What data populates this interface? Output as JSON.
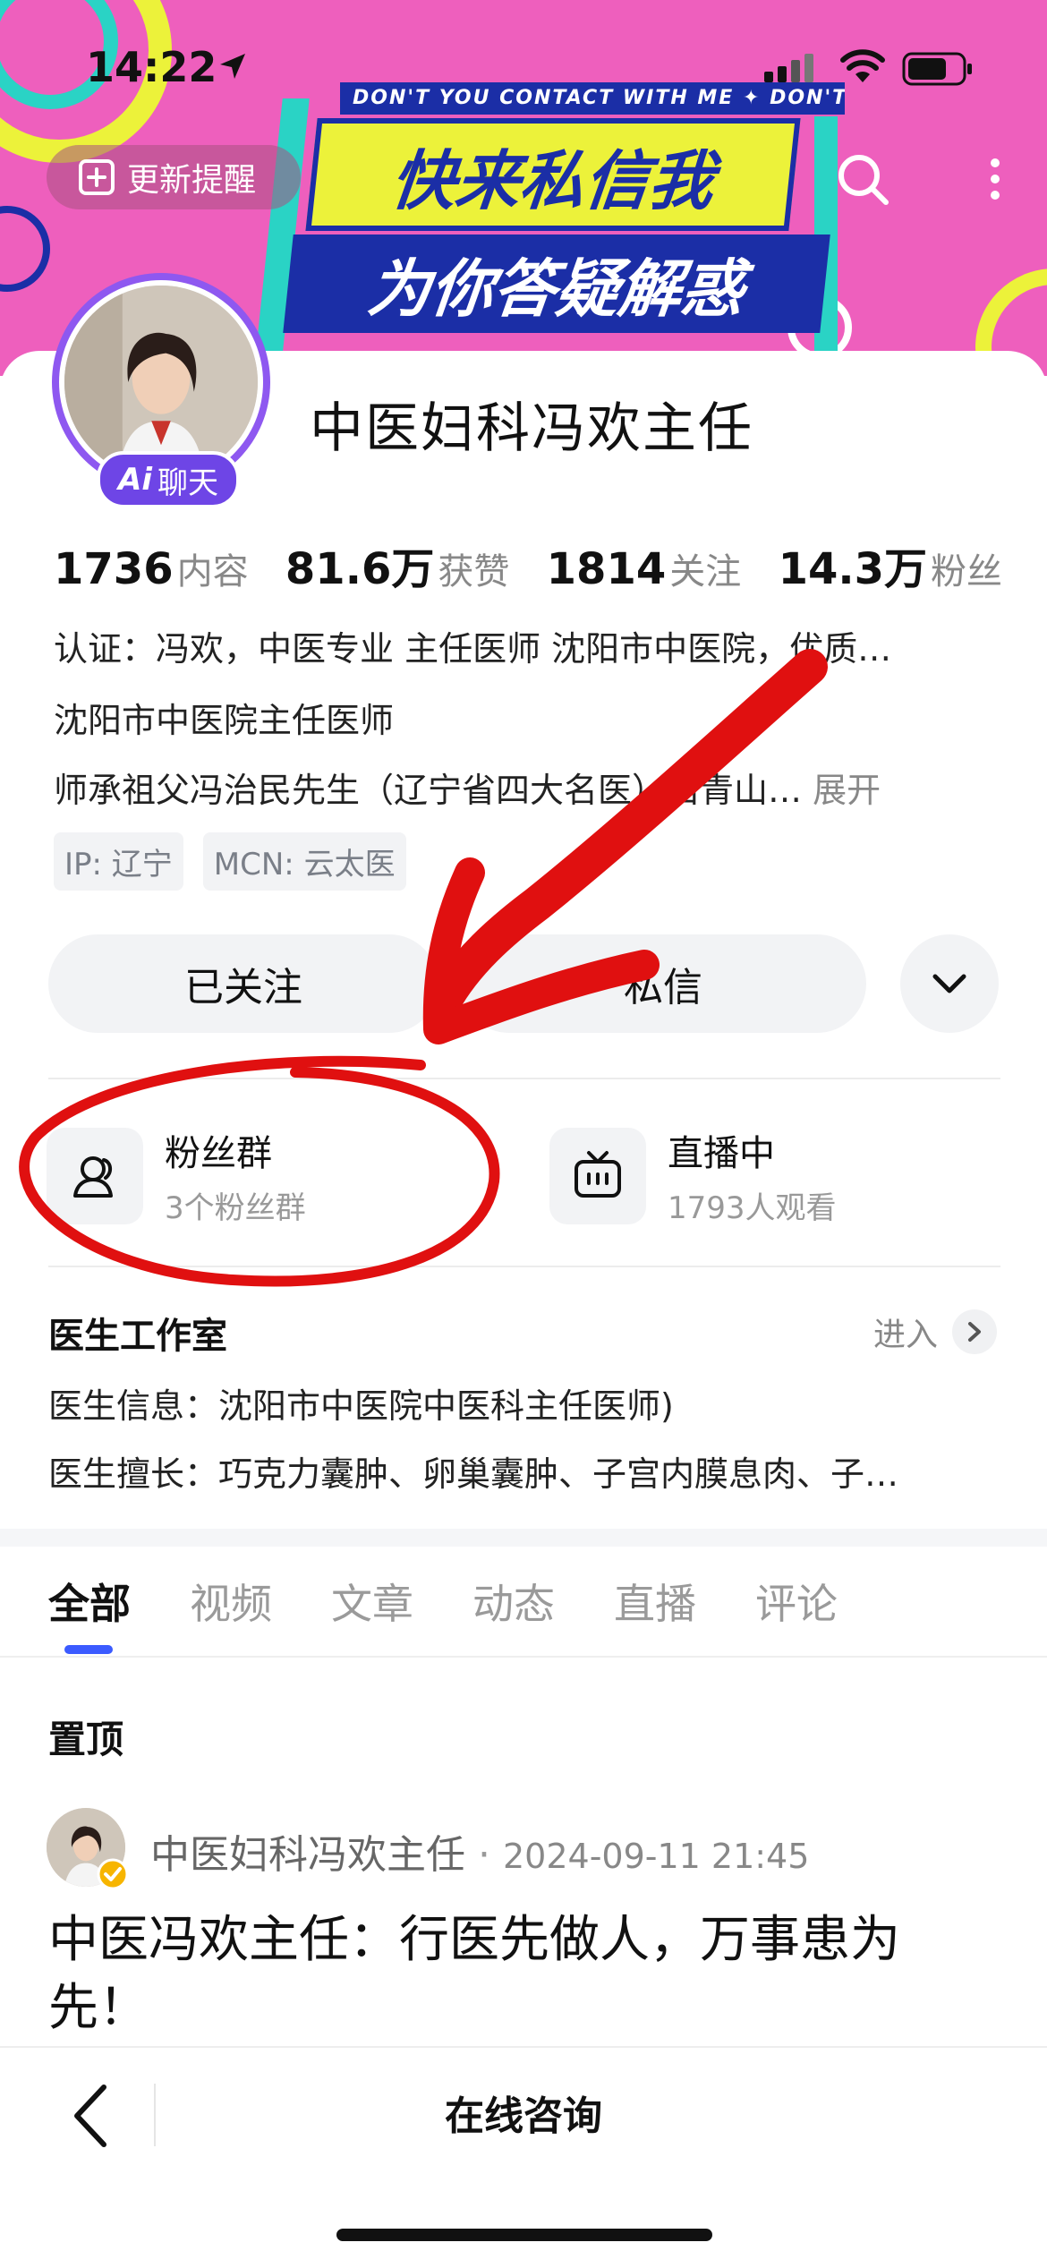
{
  "status_bar": {
    "time": "14:22"
  },
  "banner": {
    "tape_text": "DON'T YOU CONTACT WITH ME ✦ DON'T YOU",
    "headline_1": "快来私信我",
    "headline_2": "为你答疑解惑",
    "update_label": "更新提醒"
  },
  "profile": {
    "name": "中医妇科冯欢主任",
    "ai_badge_prefix": "Ai",
    "ai_badge_label": "聊天",
    "stats": [
      {
        "value": "1736",
        "label": "内容"
      },
      {
        "value": "81.6万",
        "label": "获赞"
      },
      {
        "value": "1814",
        "label": "关注"
      },
      {
        "value": "14.3万",
        "label": "粉丝"
      }
    ],
    "bio": {
      "line1": "认证：冯欢，中医专业 主任医师 沈阳市中医院，优质…",
      "line2": "沈阳市中医院主任医师",
      "line3": "师承祖父冯治民先生（辽宁省四大名医）石青山…",
      "expand": "展开"
    },
    "tags": [
      "IP: 辽宁",
      "MCN: 云太医"
    ],
    "follow_label": "已关注",
    "message_label": "私信"
  },
  "features": {
    "fan_group": {
      "title": "粉丝群",
      "subtitle": "3个粉丝群"
    },
    "live": {
      "title": "直播中",
      "subtitle": "1793人观看"
    }
  },
  "studio": {
    "title": "医生工作室",
    "enter": "进入",
    "info": "医生信息：沈阳市中医院中医科主任医师)",
    "expertise": "医生擅长：巧克力囊肿、卵巢囊肿、子宫内膜息肉、子…"
  },
  "tabs": [
    "全部",
    "视频",
    "文章",
    "动态",
    "直播",
    "评论"
  ],
  "pinned_label": "置顶",
  "post": {
    "author": "中医妇科冯欢主任",
    "date": "2024-09-11 21:45",
    "title": "中医冯欢主任：行医先做人，万事患为先！"
  },
  "bottom_bar": {
    "consult_label": "在线咨询"
  },
  "colors": {
    "banner_pink": "#ee5fbd",
    "banner_blue": "#1b2ea6",
    "banner_yellow": "#ecf23a",
    "ai_purple": "#6e45e6",
    "tab_indicator": "#3b5bff",
    "annotation_red": "#e01010"
  }
}
